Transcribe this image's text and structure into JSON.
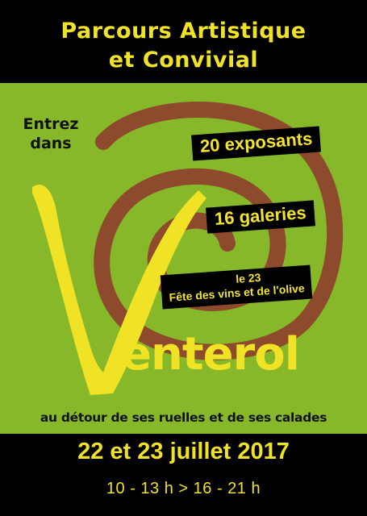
{
  "header": {
    "title_line1": "Parcours Artistique",
    "title_line2": "et Convivial"
  },
  "intro": {
    "line1": "Entrez",
    "line2": "dans"
  },
  "badges": {
    "exhibitors": "20 exposants",
    "galleries": "16 galeries",
    "festival_day": "le 23",
    "festival_name": "Fête des vins et de l'olive"
  },
  "village": {
    "initial": "V",
    "rest": "enterol"
  },
  "tagline": "au détour de ses ruelles et de ses calades",
  "footer": {
    "dates": "22 et 23 juillet 2017",
    "hours": "10 - 13 h  > 16 - 21 h"
  },
  "colors": {
    "background": "#000000",
    "green": "#86b82a",
    "yellow": "#f0e225",
    "spiral": "#8d4a2c"
  }
}
